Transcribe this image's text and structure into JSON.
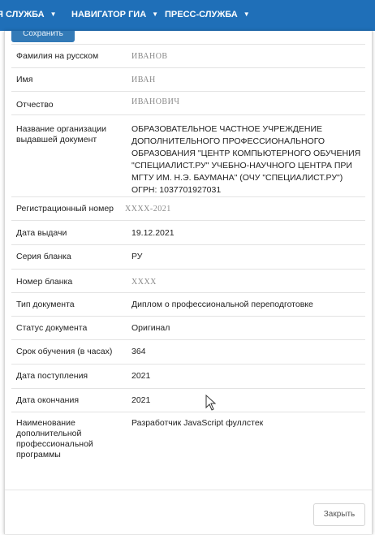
{
  "nav": {
    "items": [
      {
        "label": "Я СЛУЖБА"
      },
      {
        "label": "НАВИГАТОР ГИА"
      },
      {
        "label": "ПРЕСС-СЛУЖБА"
      }
    ]
  },
  "modal": {
    "save_label": "Сохранить",
    "close_label": "Закрыть",
    "rows": [
      {
        "label": "Фамилия на русском",
        "value": "ИВАНОВ"
      },
      {
        "label": "Имя",
        "value": "ИВАН"
      },
      {
        "label": "Отчество",
        "value": "ИВАНОВИЧ"
      },
      {
        "label": "Название организации выдавшей документ",
        "value": "ОБРАЗОВАТЕЛЬНОЕ ЧАСТНОЕ УЧРЕЖДЕНИЕ ДОПОЛНИТЕЛЬНОГО ПРОФЕССИОНАЛЬНОГО ОБРАЗОВАНИЯ \"ЦЕНТР КОМПЬЮТЕРНОГО ОБУЧЕНИЯ \"СПЕЦИАЛИСТ.РУ\" УЧЕБНО-НАУЧНОГО ЦЕНТРА ПРИ МГТУ ИМ. Н.Э. БАУМАНА\" (ОЧУ \"СПЕЦИАЛИСТ.РУ\") ОГРН: 1037701927031"
      },
      {
        "label": "Регистрационный номер",
        "value": "XXXX-2021"
      },
      {
        "label": "Дата выдачи",
        "value": "19.12.2021"
      },
      {
        "label": "Серия бланка",
        "value": "РУ"
      },
      {
        "label": "Номер бланка",
        "value": "XXXX"
      },
      {
        "label": "Тип документа",
        "value": "Диплом о профессиональной переподготовке"
      },
      {
        "label": "Статус документа",
        "value": "Оригинал"
      },
      {
        "label": "Срок обучения (в часах)",
        "value": "364"
      },
      {
        "label": "Дата поступления",
        "value": "2021"
      },
      {
        "label": "Дата окончания",
        "value": "2021"
      },
      {
        "label": "Наименование дополнительной профессиональной программы",
        "value": "Разработчик JavaScript фуллстек"
      }
    ]
  }
}
